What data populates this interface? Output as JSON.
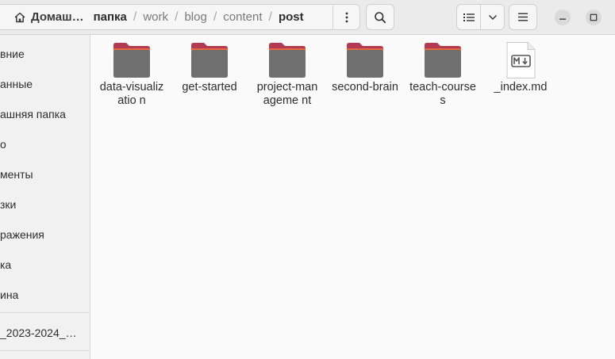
{
  "pathbar": {
    "crumbs": [
      "Домаш…",
      "папка",
      "work",
      "blog",
      "content",
      "post"
    ],
    "separator": "/"
  },
  "sidebar": {
    "items": [
      "вние",
      "анные",
      "ашняя папка",
      "о",
      "менты",
      "зки",
      "ражения",
      "ка",
      "ина"
    ],
    "bookmark": "_2023-2024_…"
  },
  "files": [
    {
      "name": "data-visualizatio n",
      "type": "folder"
    },
    {
      "name": "get-started",
      "type": "folder"
    },
    {
      "name": "project-manageme nt",
      "type": "folder"
    },
    {
      "name": "second-brain",
      "type": "folder"
    },
    {
      "name": "teach-courses",
      "type": "folder"
    },
    {
      "name": "_index.md",
      "type": "markdown"
    }
  ],
  "icons": {
    "home": "home-icon",
    "path_menu": "vertical-dots-icon",
    "search": "search-icon",
    "list_view": "list-view-icon",
    "view_options": "chevron-down-icon",
    "main_menu": "hamburger-icon",
    "minimize": "minimize-icon",
    "maximize": "maximize-icon",
    "folder": "folder-icon",
    "markdown": "markdown-file-icon"
  },
  "colors": {
    "folder_body": "#6f6f6f",
    "folder_tab": "#b23a52",
    "folder_accent": "#e8663d"
  }
}
